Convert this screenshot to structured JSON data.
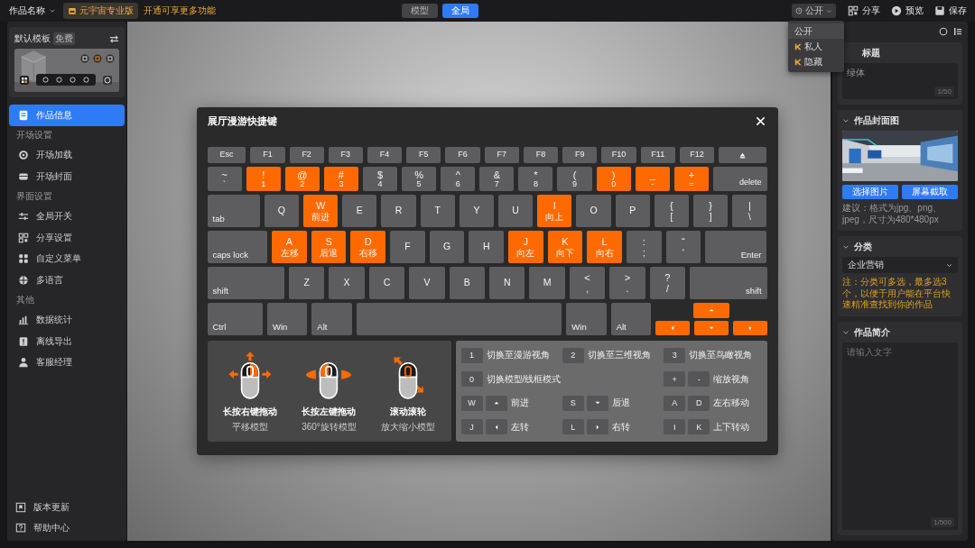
{
  "topbar": {
    "project_title": "作品名称",
    "edition_badge": "元宇宙专业版",
    "upgrade_link": "开通可享更多功能",
    "view_tabs": [
      {
        "label": "模型",
        "selected": false
      },
      {
        "label": "全局",
        "selected": true
      }
    ],
    "visibility": {
      "value": "公开",
      "options": [
        {
          "label": "公开",
          "selected": true,
          "premium": false
        },
        {
          "label": "私人",
          "selected": false,
          "premium": true
        },
        {
          "label": "隐藏",
          "selected": false,
          "premium": true
        }
      ]
    },
    "actions": [
      {
        "label": "分享",
        "kind": "share"
      },
      {
        "label": "预览",
        "kind": "preview"
      },
      {
        "label": "保存",
        "kind": "save"
      }
    ]
  },
  "sidebar": {
    "template": {
      "title": "默认模板",
      "tag": "免费"
    },
    "sections": [
      {
        "items": [
          {
            "label": "作品信息",
            "kind": "info",
            "selected": true
          }
        ]
      },
      {
        "heading": "开场设置",
        "items": [
          {
            "label": "开场加载",
            "kind": "loading",
            "selected": false
          },
          {
            "label": "开场封面",
            "kind": "cover",
            "selected": false
          }
        ]
      },
      {
        "heading": "界面设置",
        "items": [
          {
            "label": "全局开关",
            "kind": "toggle",
            "selected": false
          },
          {
            "label": "分享设置",
            "kind": "share",
            "selected": false
          },
          {
            "label": "自定义菜单",
            "kind": "menu",
            "selected": false
          },
          {
            "label": "多语言",
            "kind": "language",
            "selected": false
          }
        ]
      },
      {
        "heading": "其他",
        "items": [
          {
            "label": "数据统计",
            "kind": "stats",
            "selected": false
          },
          {
            "label": "离线导出",
            "kind": "export",
            "selected": false
          },
          {
            "label": "客服经理",
            "kind": "service",
            "selected": false
          }
        ]
      }
    ],
    "footer": [
      {
        "label": "版本更新",
        "kind": "update"
      },
      {
        "label": "帮助中心",
        "kind": "help"
      }
    ]
  },
  "modal": {
    "title": "展厅漫游快捷键",
    "keyboard": [
      [
        {
          "label": "Esc",
          "kind": "esc",
          "highlighted": false
        },
        {
          "label": "F1",
          "kind": "fn",
          "highlighted": false
        },
        {
          "label": "F2",
          "kind": "fn",
          "highlighted": false
        },
        {
          "label": "F3",
          "kind": "fn",
          "highlighted": false
        },
        {
          "label": "F4",
          "kind": "fn",
          "highlighted": false
        },
        {
          "label": "F5",
          "kind": "fn",
          "highlighted": false
        },
        {
          "label": "F6",
          "kind": "fn",
          "highlighted": false
        },
        {
          "label": "F7",
          "kind": "fn",
          "highlighted": false
        },
        {
          "label": "F8",
          "kind": "fn",
          "highlighted": false
        },
        {
          "label": "F9",
          "kind": "fn",
          "highlighted": false
        },
        {
          "label": "F10",
          "kind": "fn",
          "highlighted": false
        },
        {
          "label": "F11",
          "kind": "fn",
          "highlighted": false
        },
        {
          "label": "F12",
          "kind": "fn",
          "highlighted": false
        },
        {
          "kind": "eject",
          "highlighted": false
        }
      ],
      [
        {
          "label": "~",
          "sub": "`",
          "kind": "key",
          "highlighted": false
        },
        {
          "label": "!",
          "sub": "1",
          "kind": "key",
          "highlighted": true
        },
        {
          "label": "@",
          "sub": "2",
          "kind": "key",
          "highlighted": true
        },
        {
          "label": "#",
          "sub": "3",
          "kind": "key",
          "highlighted": true
        },
        {
          "label": "$",
          "sub": "4",
          "kind": "key",
          "highlighted": false
        },
        {
          "label": "%",
          "sub": "5",
          "kind": "key",
          "highlighted": false
        },
        {
          "label": "^",
          "sub": "6",
          "kind": "key",
          "highlighted": false
        },
        {
          "label": "&",
          "sub": "7",
          "kind": "key",
          "highlighted": false
        },
        {
          "label": "*",
          "sub": "8",
          "kind": "key",
          "highlighted": false
        },
        {
          "label": "(",
          "sub": "9",
          "kind": "key",
          "highlighted": false
        },
        {
          "label": ")",
          "sub": "0",
          "kind": "key",
          "highlighted": true
        },
        {
          "label": "_",
          "sub": "-",
          "kind": "key",
          "highlighted": true
        },
        {
          "label": "+",
          "sub": "=",
          "kind": "key",
          "highlighted": true
        },
        {
          "label": "delete",
          "kind": "delete",
          "highlighted": false
        }
      ],
      [
        {
          "label": "tab",
          "kind": "tab",
          "highlighted": false
        },
        {
          "label": "Q",
          "kind": "key",
          "highlighted": false
        },
        {
          "label": "W",
          "sub": "前进",
          "kind": "key",
          "highlighted": true
        },
        {
          "label": "E",
          "kind": "key",
          "highlighted": false
        },
        {
          "label": "R",
          "kind": "key",
          "highlighted": false
        },
        {
          "label": "T",
          "kind": "key",
          "highlighted": false
        },
        {
          "label": "Y",
          "kind": "key",
          "highlighted": false
        },
        {
          "label": "U",
          "kind": "key",
          "highlighted": false
        },
        {
          "label": "I",
          "sub": "向上",
          "kind": "key",
          "highlighted": true
        },
        {
          "label": "O",
          "kind": "key",
          "highlighted": false
        },
        {
          "label": "P",
          "kind": "key",
          "highlighted": false
        },
        {
          "label": "{",
          "sub": "[",
          "kind": "key",
          "highlighted": false
        },
        {
          "label": "}",
          "sub": "]",
          "kind": "key",
          "highlighted": false
        },
        {
          "label": "|",
          "sub": "\\",
          "kind": "key",
          "highlighted": false
        }
      ],
      [
        {
          "label": "caps lock",
          "kind": "caps",
          "highlighted": false
        },
        {
          "label": "A",
          "sub": "左移",
          "kind": "key",
          "highlighted": true
        },
        {
          "label": "S",
          "sub": "后退",
          "kind": "key",
          "highlighted": true
        },
        {
          "label": "D",
          "sub": "右移",
          "kind": "key",
          "highlighted": true
        },
        {
          "label": "F",
          "kind": "key",
          "highlighted": false
        },
        {
          "label": "G",
          "kind": "key",
          "highlighted": false
        },
        {
          "label": "H",
          "kind": "key",
          "highlighted": false
        },
        {
          "label": "J",
          "sub": "向左",
          "kind": "key",
          "highlighted": true
        },
        {
          "label": "K",
          "sub": "向下",
          "kind": "key",
          "highlighted": true
        },
        {
          "label": "L",
          "sub": "向右",
          "kind": "key",
          "highlighted": true
        },
        {
          "label": ":",
          "sub": ";",
          "kind": "key",
          "highlighted": false
        },
        {
          "label": "“",
          "sub": "‘",
          "kind": "key",
          "highlighted": false
        },
        {
          "label": "Enter",
          "kind": "enter",
          "highlighted": false
        }
      ],
      [
        {
          "label": "shift",
          "kind": "lshift",
          "highlighted": false
        },
        {
          "label": "Z",
          "kind": "key",
          "highlighted": false
        },
        {
          "label": "X",
          "kind": "key",
          "highlighted": false
        },
        {
          "label": "C",
          "kind": "key",
          "highlighted": false
        },
        {
          "label": "V",
          "kind": "key",
          "highlighted": false
        },
        {
          "label": "B",
          "kind": "key",
          "highlighted": false
        },
        {
          "label": "N",
          "kind": "key",
          "highlighted": false
        },
        {
          "label": "M",
          "kind": "key",
          "highlighted": false
        },
        {
          "label": "<",
          "sub": ",",
          "kind": "key",
          "highlighted": false
        },
        {
          "label": ">",
          "sub": ".",
          "kind": "key",
          "highlighted": false
        },
        {
          "label": "?",
          "sub": "/",
          "kind": "key",
          "highlighted": false
        },
        {
          "label": "shift",
          "kind": "rshift",
          "highlighted": false
        }
      ],
      [
        {
          "label": "Ctrl",
          "kind": "ctrl",
          "highlighted": false
        },
        {
          "label": "Win",
          "kind": "mod",
          "highlighted": false
        },
        {
          "label": "Alt",
          "kind": "mod",
          "highlighted": false
        },
        {
          "kind": "space",
          "highlighted": false
        },
        {
          "label": "Win",
          "kind": "mod",
          "highlighted": false
        },
        {
          "label": "Alt",
          "kind": "mod",
          "highlighted": false
        },
        {
          "kind": "arrows",
          "highlighted": true
        }
      ]
    ],
    "mouse_hints": [
      {
        "title": "长按右键拖动",
        "caption": "平移模型",
        "kind": "right"
      },
      {
        "title": "长按左键拖动",
        "caption": "360°旋转模型",
        "kind": "left"
      },
      {
        "title": "滚动滚轮",
        "caption": "放大缩小模型",
        "kind": "wheel"
      }
    ],
    "shortcuts": [
      [
        {
          "keys": [
            {
              "text": "1"
            }
          ],
          "label": "切换至漫游视角",
          "kind": "normal"
        },
        {
          "keys": [
            {
              "text": "2"
            }
          ],
          "label": "切换至三维视角",
          "kind": "normal"
        },
        {
          "keys": [
            {
              "text": "3"
            }
          ],
          "label": "切换至鸟瞰视角",
          "kind": "normal"
        }
      ],
      [
        {
          "keys": [
            {
              "text": "0"
            }
          ],
          "label": "切换模型/线框模式",
          "kind": "wide"
        },
        {
          "keys": [
            {
              "text": "+"
            },
            {
              "text": "-"
            }
          ],
          "label": "缩放视角",
          "kind": "normal"
        }
      ],
      [
        {
          "keys": [
            {
              "text": "W"
            },
            {
              "kind": "up"
            }
          ],
          "label": "前进",
          "kind": "normal"
        },
        {
          "keys": [
            {
              "text": "S"
            },
            {
              "kind": "down"
            }
          ],
          "label": "后退",
          "kind": "normal"
        },
        {
          "keys": [
            {
              "text": "A"
            },
            {
              "text": "D"
            }
          ],
          "label": "左右移动",
          "kind": "normal"
        }
      ],
      [
        {
          "keys": [
            {
              "text": "J"
            },
            {
              "kind": "left"
            }
          ],
          "label": "左转",
          "kind": "normal"
        },
        {
          "keys": [
            {
              "text": "L"
            },
            {
              "kind": "right"
            }
          ],
          "label": "右转",
          "kind": "normal"
        },
        {
          "keys": [
            {
              "text": "I"
            },
            {
              "text": "K"
            }
          ],
          "label": "上下转动",
          "kind": "normal"
        }
      ]
    ]
  },
  "right_panel": {
    "title_section": {
      "heading": "标题",
      "value": "绿体",
      "counter": "1/50"
    },
    "cover": {
      "heading": "作品封面图",
      "buttons": [
        "选择图片",
        "屏幕截取"
      ],
      "hint": "建议：格式为jpg、png、jpeg，尺寸为480*480px"
    },
    "category": {
      "heading": "分类",
      "value": "企业营销",
      "note": "注：分类可多选，最多选3个，以便于用户能在平台快速精准查找到你的作品"
    },
    "intro": {
      "heading": "作品简介",
      "placeholder": "请输入文字",
      "counter": "1/500"
    }
  }
}
